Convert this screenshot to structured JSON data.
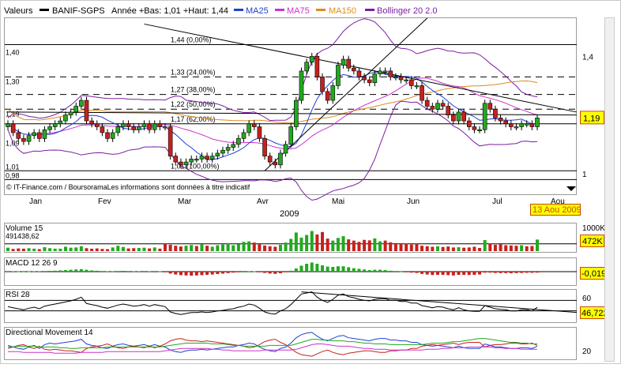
{
  "header": {
    "label": "Valeurs",
    "ticker": "BANIF-SGPS",
    "range_text": "Année +Bas: 1,01 +Haut: 1,44",
    "indicators": [
      {
        "name": "MA25",
        "color": "#1f3fd6"
      },
      {
        "name": "MA75",
        "color": "#cc33cc"
      },
      {
        "name": "MA150",
        "color": "#e08a1e"
      },
      {
        "name": "Bollinger 20 2.0",
        "color": "#7b1fa2"
      }
    ]
  },
  "credit": "© IT-Finance.com / BoursoramaLes informations sont données à titre indicatif",
  "colors": {
    "up": "#22a91f",
    "down": "#c8201c",
    "price_line": "#000000",
    "accent_box": "#ffff00"
  },
  "chart_data": [
    {
      "type": "candlestick",
      "ylim": [
        0.93,
        1.53
      ],
      "y_ticks_left": [
        1.01,
        0.98,
        1.09,
        1.19,
        1.3,
        1.4
      ],
      "y_ticks_left_labels": [
        "1,01",
        "0,98",
        "1,09",
        "1,19",
        "1,30",
        "1,40"
      ],
      "y_ticks_right": [
        1.0,
        1.4
      ],
      "y_ticks_right_labels": [
        "1",
        "1,4"
      ],
      "x_months": [
        "Jan",
        "Fev",
        "Mar",
        "Avr",
        "Mai",
        "Jun",
        "Jul",
        "Aou"
      ],
      "x_year": "2009",
      "current_value": "1,19",
      "current_date": "13 Aou 2009",
      "fibonacci_levels": [
        {
          "value": 1.44,
          "label": "1,44 (0,00%)"
        },
        {
          "value": 1.33,
          "label": "1,33 (24,00%)"
        },
        {
          "value": 1.27,
          "label": "1,27 (38,00%)"
        },
        {
          "value": 1.22,
          "label": "1,22 (50,00%)"
        },
        {
          "value": 1.17,
          "label": "1,17 (62,00%)"
        },
        {
          "value": 1.01,
          "label": "1,01 (100,00%)"
        }
      ],
      "close_series": [
        1.17,
        1.14,
        1.12,
        1.11,
        1.13,
        1.14,
        1.12,
        1.15,
        1.16,
        1.17,
        1.18,
        1.2,
        1.21,
        1.23,
        1.25,
        1.18,
        1.17,
        1.16,
        1.14,
        1.12,
        1.14,
        1.16,
        1.17,
        1.16,
        1.15,
        1.16,
        1.17,
        1.15,
        1.17,
        1.16,
        1.16,
        1.06,
        1.04,
        1.03,
        1.04,
        1.05,
        1.05,
        1.06,
        1.05,
        1.06,
        1.07,
        1.08,
        1.09,
        1.1,
        1.12,
        1.14,
        1.17,
        1.16,
        1.12,
        1.06,
        1.04,
        1.03,
        1.07,
        1.1,
        1.16,
        1.25,
        1.35,
        1.38,
        1.4,
        1.33,
        1.28,
        1.25,
        1.3,
        1.37,
        1.39,
        1.36,
        1.35,
        1.33,
        1.32,
        1.31,
        1.34,
        1.35,
        1.35,
        1.33,
        1.33,
        1.32,
        1.32,
        1.3,
        1.3,
        1.25,
        1.23,
        1.22,
        1.24,
        1.23,
        1.2,
        1.18,
        1.21,
        1.18,
        1.16,
        1.15,
        1.15,
        1.24,
        1.22,
        1.19,
        1.18,
        1.17,
        1.16,
        1.16,
        1.17,
        1.17,
        1.16,
        1.19
      ]
    },
    {
      "type": "bar",
      "title": "Volume 15",
      "value_text": "491438,62",
      "y_ticks": [
        "1000K"
      ],
      "current_value": "472K",
      "values": [
        140,
        90,
        110,
        100,
        120,
        100,
        80,
        160,
        120,
        100,
        100,
        180,
        140,
        150,
        200,
        120,
        100,
        110,
        90,
        80,
        150,
        220,
        170,
        110,
        120,
        130,
        140,
        110,
        150,
        100,
        300,
        260,
        220,
        190,
        220,
        250,
        210,
        280,
        220,
        180,
        240,
        270,
        330,
        240,
        290,
        380,
        400,
        350,
        280,
        230,
        200,
        180,
        260,
        350,
        500,
        760,
        550,
        660,
        820,
        680,
        780,
        510,
        430,
        540,
        610,
        480,
        430,
        380,
        460,
        440,
        520,
        400,
        430,
        360,
        330,
        280,
        310,
        270,
        300,
        220,
        200,
        180,
        200,
        170,
        190,
        150,
        160,
        140,
        150,
        180,
        130,
        450,
        320,
        260,
        280,
        240,
        230,
        220,
        240,
        200,
        210,
        472
      ],
      "up": [
        true,
        false,
        false,
        false,
        true,
        true,
        false,
        true,
        true,
        true,
        true,
        true,
        true,
        true,
        true,
        false,
        false,
        false,
        false,
        false,
        true,
        true,
        true,
        false,
        false,
        true,
        true,
        false,
        true,
        false,
        false,
        false,
        false,
        false,
        true,
        true,
        false,
        true,
        false,
        true,
        true,
        true,
        true,
        true,
        true,
        true,
        true,
        false,
        false,
        false,
        false,
        false,
        true,
        true,
        true,
        true,
        true,
        true,
        true,
        false,
        false,
        false,
        true,
        true,
        true,
        false,
        false,
        false,
        false,
        false,
        true,
        true,
        false,
        false,
        false,
        false,
        false,
        false,
        false,
        false,
        false,
        false,
        true,
        false,
        false,
        false,
        true,
        false,
        false,
        false,
        false,
        true,
        false,
        false,
        false,
        false,
        false,
        false,
        true,
        false,
        false,
        true
      ],
      "ylim": [
        0,
        1000
      ]
    },
    {
      "type": "bar",
      "title": "MACD 12 26 9",
      "current_value": "-0,0198",
      "ylim": [
        -0.08,
        0.08
      ],
      "values": [
        0.004,
        0.003,
        0.002,
        0.001,
        0.002,
        0.003,
        0.003,
        0.004,
        0.005,
        0.006,
        0.008,
        0.01,
        0.012,
        0.014,
        0.016,
        0.012,
        0.008,
        0.006,
        0.004,
        0.003,
        0.003,
        0.004,
        0.005,
        0.004,
        0.003,
        0.003,
        0.004,
        0.003,
        0.004,
        0.002,
        -0.004,
        -0.012,
        -0.018,
        -0.022,
        -0.024,
        -0.025,
        -0.024,
        -0.022,
        -0.02,
        -0.018,
        -0.015,
        -0.012,
        -0.009,
        -0.006,
        -0.003,
        0.0,
        0.003,
        0.002,
        -0.002,
        -0.008,
        -0.012,
        -0.014,
        -0.01,
        -0.004,
        0.006,
        0.02,
        0.038,
        0.05,
        0.058,
        0.05,
        0.04,
        0.032,
        0.03,
        0.034,
        0.034,
        0.028,
        0.022,
        0.018,
        0.014,
        0.01,
        0.012,
        0.012,
        0.01,
        0.006,
        0.004,
        0.001,
        -0.002,
        -0.006,
        -0.008,
        -0.014,
        -0.018,
        -0.021,
        -0.02,
        -0.02,
        -0.022,
        -0.024,
        -0.02,
        -0.02,
        -0.021,
        -0.02,
        -0.018,
        -0.006,
        -0.006,
        -0.008,
        -0.009,
        -0.009,
        -0.01,
        -0.009,
        -0.008,
        -0.007,
        -0.007,
        -0.006
      ]
    },
    {
      "type": "line",
      "title": "RSI 28",
      "current_value": "46,722",
      "y_ticks": [
        "60",
        "40"
      ],
      "ylim": [
        20,
        80
      ],
      "values": [
        48,
        46,
        44,
        42,
        45,
        47,
        44,
        49,
        51,
        53,
        55,
        57,
        59,
        62,
        66,
        54,
        52,
        50,
        47,
        45,
        48,
        51,
        53,
        51,
        49,
        50,
        52,
        49,
        52,
        50,
        48,
        38,
        35,
        33,
        35,
        37,
        37,
        38,
        37,
        38,
        40,
        41,
        43,
        44,
        47,
        49,
        53,
        51,
        45,
        38,
        35,
        34,
        40,
        44,
        52,
        62,
        72,
        74,
        76,
        66,
        60,
        56,
        62,
        70,
        72,
        67,
        65,
        62,
        60,
        59,
        62,
        63,
        63,
        60,
        60,
        58,
        58,
        55,
        55,
        50,
        48,
        46,
        48,
        47,
        44,
        42,
        46,
        42,
        40,
        39,
        39,
        50,
        47,
        44,
        43,
        42,
        40,
        40,
        42,
        42,
        40,
        46.722
      ],
      "trendline": [
        [
          56,
          76
        ],
        [
          101,
          41
        ]
      ]
    },
    {
      "type": "line",
      "title": "Directional Movement 14",
      "y_ticks": [
        "20"
      ],
      "ylim": [
        5,
        45
      ],
      "series": [
        {
          "color": "#1f3fd6",
          "values": [
            22,
            20,
            18,
            17,
            20,
            22,
            18,
            23,
            25,
            24,
            25,
            26,
            27,
            28,
            30,
            24,
            22,
            21,
            19,
            18,
            21,
            23,
            24,
            22,
            21,
            22,
            23,
            21,
            23,
            21,
            20,
            16,
            14,
            13,
            15,
            16,
            16,
            17,
            16,
            17,
            18,
            19,
            20,
            20,
            22,
            23,
            25,
            24,
            20,
            17,
            15,
            14,
            18,
            20,
            25,
            32,
            36,
            38,
            39,
            34,
            30,
            28,
            31,
            34,
            35,
            32,
            31,
            30,
            29,
            28,
            30,
            31,
            31,
            29,
            29,
            28,
            28,
            26,
            26,
            23,
            22,
            21,
            22,
            21,
            20,
            19,
            21,
            19,
            18,
            18,
            18,
            24,
            22,
            20,
            20,
            19,
            18,
            18,
            19,
            19,
            18,
            21
          ]
        },
        {
          "color": "#c8201c",
          "values": [
            18,
            20,
            22,
            23,
            20,
            18,
            21,
            17,
            16,
            17,
            16,
            15,
            15,
            14,
            13,
            18,
            20,
            21,
            22,
            24,
            21,
            19,
            18,
            20,
            21,
            20,
            19,
            21,
            19,
            21,
            24,
            28,
            30,
            31,
            29,
            28,
            28,
            27,
            28,
            27,
            26,
            25,
            24,
            23,
            22,
            21,
            19,
            20,
            23,
            27,
            29,
            30,
            26,
            23,
            18,
            13,
            10,
            9,
            8,
            11,
            14,
            16,
            13,
            11,
            10,
            12,
            13,
            14,
            15,
            15,
            14,
            13,
            13,
            15,
            15,
            16,
            16,
            18,
            18,
            21,
            22,
            23,
            22,
            23,
            24,
            25,
            23,
            25,
            26,
            26,
            26,
            20,
            22,
            23,
            23,
            24,
            25,
            25,
            24,
            24,
            25,
            22
          ]
        },
        {
          "color": "#22a91f",
          "values": [
            20,
            20,
            21,
            21,
            21,
            21,
            20,
            20,
            20,
            20,
            19,
            19,
            18,
            18,
            19,
            19,
            19,
            19,
            19,
            20,
            20,
            20,
            20,
            20,
            20,
            20,
            20,
            20,
            20,
            20,
            21,
            22,
            23,
            24,
            25,
            25,
            25,
            25,
            25,
            24,
            24,
            24,
            23,
            22,
            22,
            21,
            21,
            21,
            21,
            21,
            22,
            22,
            22,
            22,
            22,
            24,
            26,
            28,
            30,
            30,
            29,
            29,
            28,
            28,
            28,
            27,
            27,
            26,
            25,
            25,
            24,
            24,
            24,
            23,
            23,
            23,
            23,
            23,
            23,
            23,
            24,
            25,
            25,
            25,
            26,
            27,
            27,
            28,
            29,
            30,
            31,
            31,
            30,
            29,
            28,
            27,
            26,
            26,
            25,
            25,
            24,
            24
          ]
        },
        {
          "color": "#cc33cc",
          "values": [
            14,
            14,
            14,
            13,
            13,
            13,
            13,
            13,
            13,
            12,
            12,
            12,
            12,
            12,
            13,
            13,
            13,
            13,
            13,
            14,
            14,
            14,
            14,
            14,
            14,
            14,
            14,
            14,
            14,
            14,
            15,
            16,
            17,
            18,
            18,
            18,
            18,
            18,
            18,
            17,
            17,
            16,
            16,
            15,
            15,
            15,
            15,
            15,
            15,
            16,
            16,
            16,
            16,
            16,
            16,
            17,
            19,
            21,
            23,
            24,
            24,
            23,
            22,
            21,
            21,
            21,
            20,
            19,
            18,
            18,
            17,
            17,
            17,
            16,
            16,
            16,
            16,
            16,
            16,
            16,
            17,
            17,
            17,
            18,
            18,
            19,
            19,
            19,
            20,
            20,
            20,
            20,
            20,
            19,
            19,
            18,
            18,
            18,
            17,
            17,
            17,
            17
          ]
        }
      ]
    }
  ]
}
